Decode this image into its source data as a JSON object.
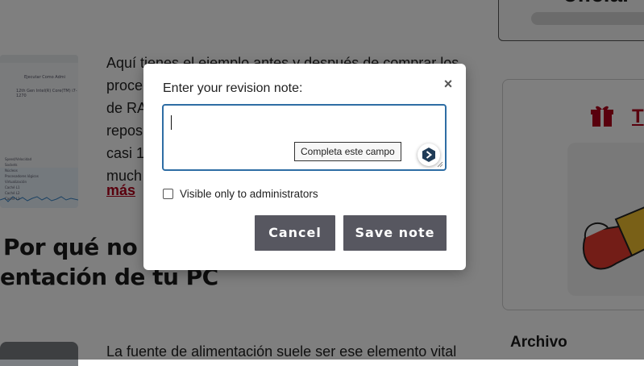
{
  "background": {
    "thumbnail": {
      "header_text": "Ejecutar Como Admi",
      "sub_text": "12th Gen Intel(R) Core(TM) i7-1270",
      "rows": [
        "Speed/Velocidad",
        "Sockets",
        "Núcleos",
        "Procesadores lógicos",
        "Virtualización",
        "Caché L1",
        "Caché L2",
        "Caché L3"
      ]
    },
    "article_lines": [
      "Aquí tienes el ejemplo antes y después de comprar los",
      "proce                                                           B",
      "de RA",
      "repos                                                          e",
      "casi 1",
      "much                                                           a"
    ],
    "more_link": "más",
    "section_heading_lines": [
      "Por qué no d",
      "entación de tu PC"
    ],
    "next_paragraph": "La fuente de alimentación suele ser ese elemento vital",
    "sidebar_top_word": "oficial",
    "product_link_letter": "T",
    "archive_heading": "Archivo"
  },
  "dialog": {
    "title": "Enter your revision note:",
    "close_symbol": "×",
    "note_value": "",
    "validation_tooltip": "Completa este campo",
    "checkbox_label": "Visible only to administrators",
    "checkbox_checked": false,
    "cancel_label": "Cancel",
    "save_label": "Save note"
  },
  "colors": {
    "button_bg": "#575760",
    "focus_border": "#2e6da4",
    "link_red": "#b3001b",
    "overlay": "rgba(0,0,0,0.5)"
  },
  "icons": {
    "close": "close-icon",
    "extension": "grammar-extension-icon",
    "gift": "gift-icon",
    "resize": "resize-handle-icon"
  }
}
